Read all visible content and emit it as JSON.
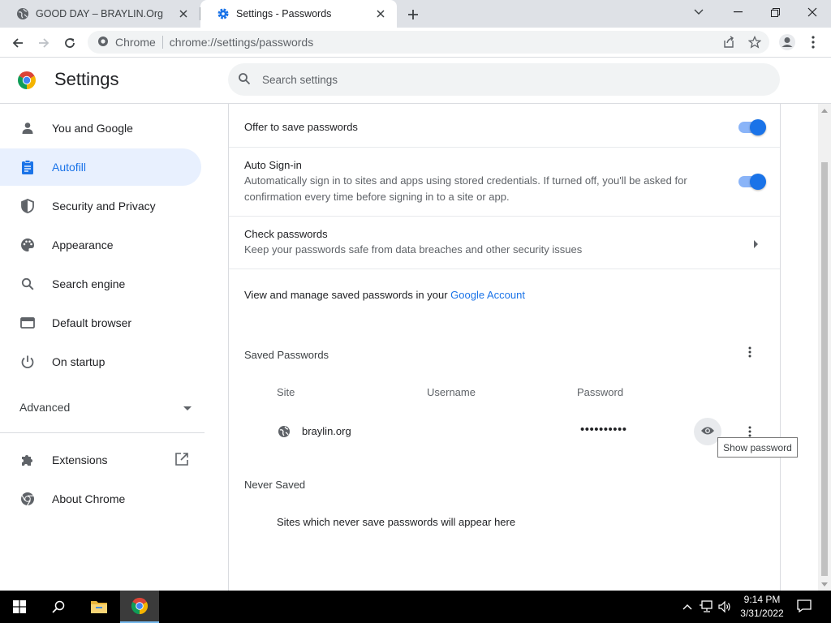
{
  "browser": {
    "tabs": [
      {
        "title": "GOOD DAY – BRAYLIN.Org",
        "active": false
      },
      {
        "title": "Settings - Passwords",
        "active": true
      }
    ],
    "omnibox": {
      "site_label": "Chrome",
      "url": "chrome://settings/passwords"
    }
  },
  "settings": {
    "title": "Settings",
    "search_placeholder": "Search settings"
  },
  "sidebar": {
    "items": [
      {
        "label": "You and Google",
        "icon": "person-icon"
      },
      {
        "label": "Autofill",
        "icon": "autofill-clipboard-icon",
        "selected": true
      },
      {
        "label": "Security and Privacy",
        "icon": "shield-icon"
      },
      {
        "label": "Appearance",
        "icon": "palette-icon"
      },
      {
        "label": "Search engine",
        "icon": "search-icon"
      },
      {
        "label": "Default browser",
        "icon": "browser-window-icon"
      },
      {
        "label": "On startup",
        "icon": "power-icon"
      }
    ],
    "advanced_label": "Advanced",
    "bottom_items": [
      {
        "label": "Extensions",
        "icon": "puzzle-icon"
      },
      {
        "label": "About Chrome",
        "icon": "chrome-logo-icon"
      }
    ]
  },
  "passwords": {
    "offer_to_save": {
      "title": "Offer to save passwords",
      "enabled": true
    },
    "auto_signin": {
      "title": "Auto Sign-in",
      "subtitle": "Automatically sign in to sites and apps using stored credentials. If turned off, you'll be asked for confirmation every time before signing in to a site or app.",
      "enabled": true
    },
    "check_passwords": {
      "title": "Check passwords",
      "subtitle": "Keep your passwords safe from data breaches and other security issues"
    },
    "manage": {
      "prefix": "View and manage saved passwords in your ",
      "link": "Google Account"
    },
    "saved_section_title": "Saved Passwords",
    "columns": {
      "site": "Site",
      "username": "Username",
      "password": "Password"
    },
    "entries": [
      {
        "site": "braylin.org",
        "username": "",
        "password_masked": "••••••••••"
      }
    ],
    "show_password_tooltip": "Show password",
    "never_saved_title": "Never Saved",
    "never_saved_empty": "Sites which never save passwords will appear here"
  },
  "taskbar": {
    "time": "9:14 PM",
    "date": "3/31/2022"
  },
  "colors": {
    "accent": "#1a73e8",
    "selected_bg": "#e8f0fe",
    "toggle_track": "#8ab4f8"
  }
}
